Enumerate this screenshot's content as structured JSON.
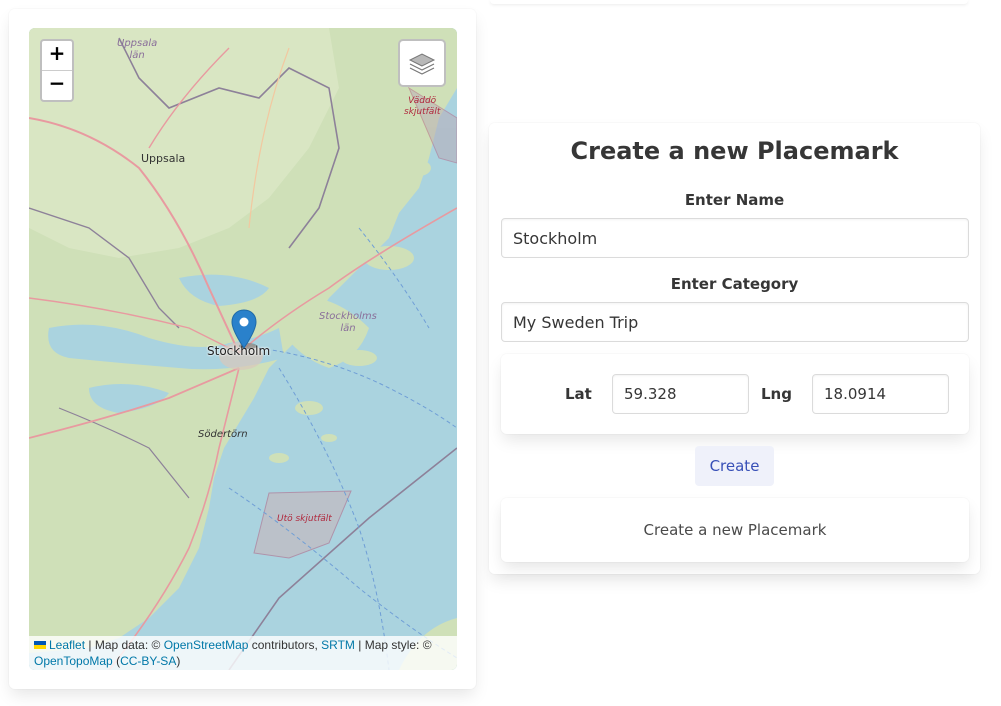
{
  "map": {
    "zoom_in_label": "+",
    "zoom_out_label": "−",
    "layers_icon": "layers-icon",
    "marker_icon": "map-marker-icon",
    "labels": {
      "uppsala_lan": [
        "Uppsala",
        "län"
      ],
      "uppsala": "Uppsala",
      "vaddo": [
        "Väddö",
        "skjutfält"
      ],
      "stockholms_lan": [
        "Stockholms",
        "län"
      ],
      "stockholm": "Stockholm",
      "sodertorn": "Södertörn",
      "uto": "Utö skjutfält"
    },
    "attribution": {
      "leaflet": "Leaflet",
      "sep1": " | Map data: © ",
      "osm": "OpenStreetMap",
      "sep2": " contributors, ",
      "srtm": "SRTM",
      "sep3": " | Map style: ©",
      "opentopo": "OpenTopoMap",
      "open_paren": " (",
      "license": "CC-BY-SA",
      "close_paren": ")"
    },
    "colors": {
      "water": "#aad3df",
      "land": "#c8dbb0",
      "marker": "#2a81cb",
      "flag_blue": "#0057b7",
      "flag_yellow": "#ffd700"
    }
  },
  "form": {
    "title": "Create a new Placemark",
    "name_label": "Enter Name",
    "name_value": "Stockholm",
    "category_label": "Enter Category",
    "category_value": "My Sweden Trip",
    "lat_label": "Lat",
    "lat_value": "59.328",
    "lng_label": "Lng",
    "lng_value": "18.0914",
    "create_button": "Create",
    "note": "Create a new Placemark"
  }
}
